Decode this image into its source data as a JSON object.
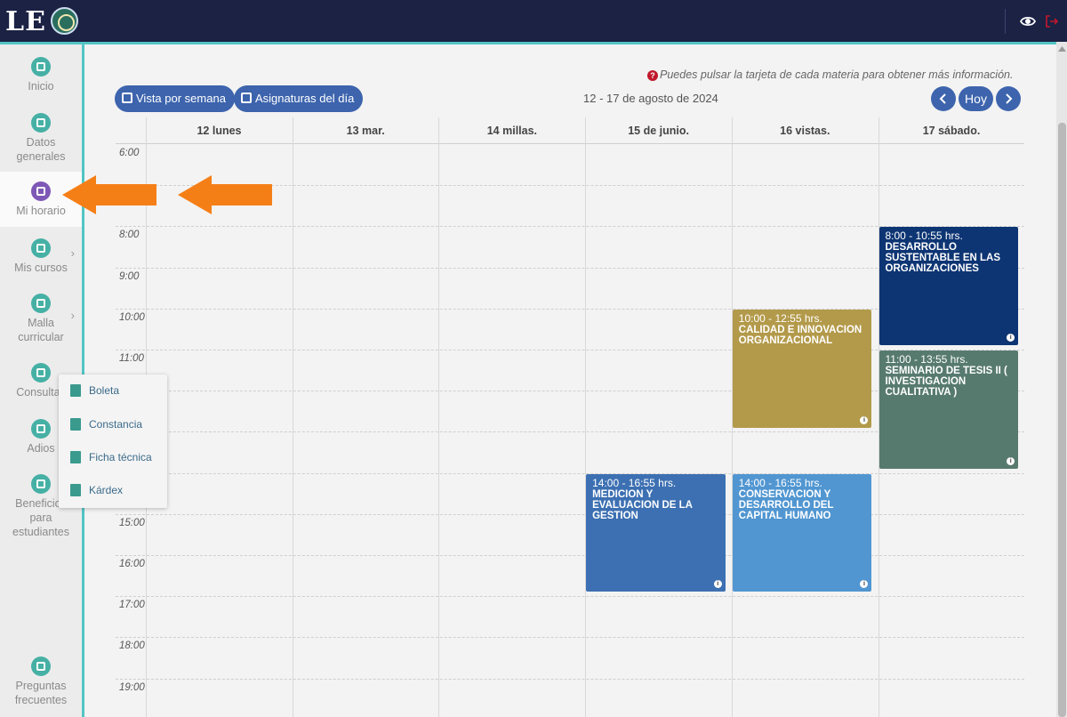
{
  "app": {
    "logo_text": "LE",
    "logo_badge": "lion-crest"
  },
  "topbar": {
    "eye_icon": "eye-icon",
    "exit_icon": "sign-out-icon",
    "exit_color": "#c0182b"
  },
  "sidebar": {
    "items": [
      {
        "label": "Inicio",
        "icon": "home-icon"
      },
      {
        "label": "Datos generales",
        "icon": "id-card-icon"
      },
      {
        "label": "Mi horario",
        "icon": "calendar-icon",
        "active": true
      },
      {
        "label": "Mis cursos",
        "icon": "map-icon",
        "has_submenu": true
      },
      {
        "label": "Malla curricular",
        "icon": "grid-icon",
        "has_submenu": true
      },
      {
        "label": "Consultas",
        "icon": "address-book-icon"
      },
      {
        "label": "Adios",
        "icon": "id-badge-icon"
      },
      {
        "label": "Beneficios para estudiantes",
        "icon": "trophy-icon"
      },
      {
        "label": "Preguntas frecuentes",
        "icon": "question-icon"
      }
    ]
  },
  "dropdown": {
    "items": [
      {
        "label": "Boleta",
        "icon": "edit-document-icon"
      },
      {
        "label": "Constancia",
        "icon": "document-check-icon"
      },
      {
        "label": "Ficha técnica",
        "icon": "document-icon"
      },
      {
        "label": "Kárdex",
        "icon": "document-icon"
      }
    ]
  },
  "toolbar": {
    "hint": "Puedes pulsar la tarjeta de cada materia para obtener más información.",
    "week_view_label": "Vista por semana",
    "day_subjects_label": "Asignaturas del día",
    "date_range": "12 - 17 de agosto de 2024",
    "today_label": "Hoy",
    "prev_icon": "chevron-left-icon",
    "next_icon": "chevron-right-icon"
  },
  "calendar": {
    "days": [
      "12 lunes",
      "13 mar.",
      "14 millas.",
      "15 de junio.",
      "16 vistas.",
      "17 sábado."
    ],
    "times": [
      "6:00",
      "",
      "8:00",
      "9:00",
      "10:00",
      "11:00",
      "",
      "",
      "",
      "15:00",
      "16:00",
      "17:00",
      "18:00",
      "19:00"
    ],
    "events": [
      {
        "day": 5,
        "start": 8,
        "end": 10.917,
        "time": "8:00 - 10:55 hrs.",
        "title": "DESARROLLO SUSTENTABLE EN LAS ORGANIZACIONES",
        "color": "#0d3573"
      },
      {
        "day": 4,
        "start": 10,
        "end": 12.917,
        "time": "10:00 - 12:55 hrs.",
        "title": "CALIDAD E INNOVACION ORGANIZACIONAL",
        "color": "#b39a4a"
      },
      {
        "day": 5,
        "start": 11,
        "end": 13.917,
        "time": "11:00 - 13:55 hrs.",
        "title": "SEMINARIO DE TESIS II ( INVESTIGACION CUALITATIVA )",
        "color": "#577a6f"
      },
      {
        "day": 3,
        "start": 14,
        "end": 16.917,
        "time": "14:00 - 16:55 hrs.",
        "title": "MEDICION Y EVALUACION DE LA GESTION",
        "color": "#3d70b2"
      },
      {
        "day": 4,
        "start": 14,
        "end": 16.917,
        "time": "14:00 - 16:55 hrs.",
        "title": "CONSERVACION Y DESARROLLO DEL CAPITAL HUMANO",
        "color": "#5196d1"
      }
    ]
  },
  "annotation": {
    "arrow_color": "#f57f17"
  }
}
